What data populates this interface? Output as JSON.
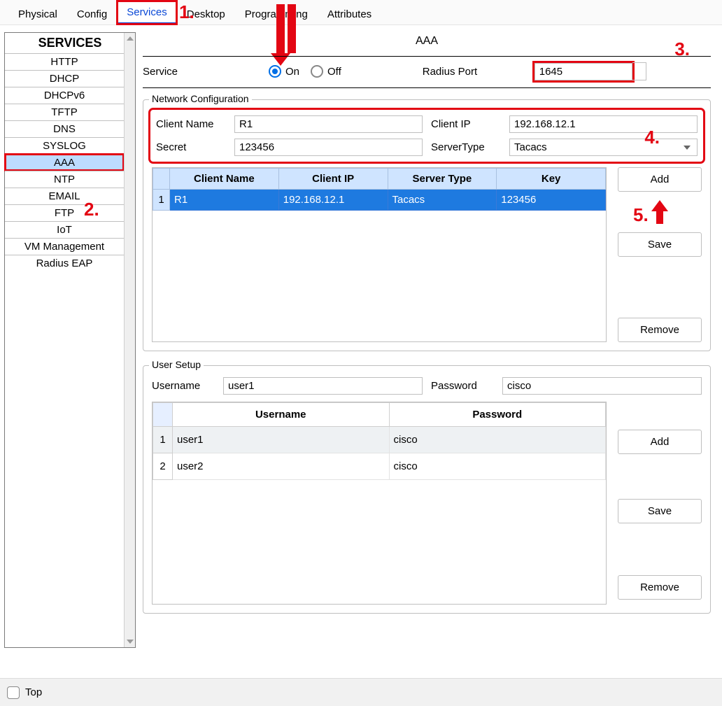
{
  "tabs": {
    "physical": "Physical",
    "config": "Config",
    "services": "Services",
    "desktop": "Desktop",
    "programming": "Programming",
    "attributes": "Attributes"
  },
  "sidebar": {
    "header": "SERVICES",
    "items": [
      "HTTP",
      "DHCP",
      "DHCPv6",
      "TFTP",
      "DNS",
      "SYSLOG",
      "AAA",
      "NTP",
      "EMAIL",
      "FTP",
      "IoT",
      "VM Management",
      "Radius EAP"
    ]
  },
  "page": {
    "title": "AAA"
  },
  "service": {
    "label": "Service",
    "on_label": "On",
    "off_label": "Off",
    "selected": "On",
    "radius_port_label": "Radius Port",
    "radius_port_value": "1645"
  },
  "network": {
    "legend": "Network Configuration",
    "client_name_label": "Client Name",
    "client_name_value": "R1",
    "client_ip_label": "Client IP",
    "client_ip_value": "192.168.12.1",
    "secret_label": "Secret",
    "secret_value": "123456",
    "server_type_label": "ServerType",
    "server_type_value": "Tacacs",
    "columns": {
      "name": "Client Name",
      "ip": "Client IP",
      "type": "Server Type",
      "key": "Key"
    },
    "rows": [
      {
        "n": "1",
        "name": "R1",
        "ip": "192.168.12.1",
        "type": "Tacacs",
        "key": "123456"
      }
    ],
    "buttons": {
      "add": "Add",
      "save": "Save",
      "remove": "Remove"
    }
  },
  "users": {
    "legend": "User Setup",
    "username_label": "Username",
    "username_value": "user1",
    "password_label": "Password",
    "password_value": "cisco",
    "columns": {
      "user": "Username",
      "pass": "Password"
    },
    "rows": [
      {
        "n": "1",
        "user": "user1",
        "pass": "cisco"
      },
      {
        "n": "2",
        "user": "user2",
        "pass": "cisco"
      }
    ],
    "buttons": {
      "add": "Add",
      "save": "Save",
      "remove": "Remove"
    }
  },
  "bottom": {
    "top_label": "Top"
  },
  "annos": {
    "a1": "1.",
    "a2": "2.",
    "a3": "3.",
    "a4": "4.",
    "a5": "5."
  }
}
